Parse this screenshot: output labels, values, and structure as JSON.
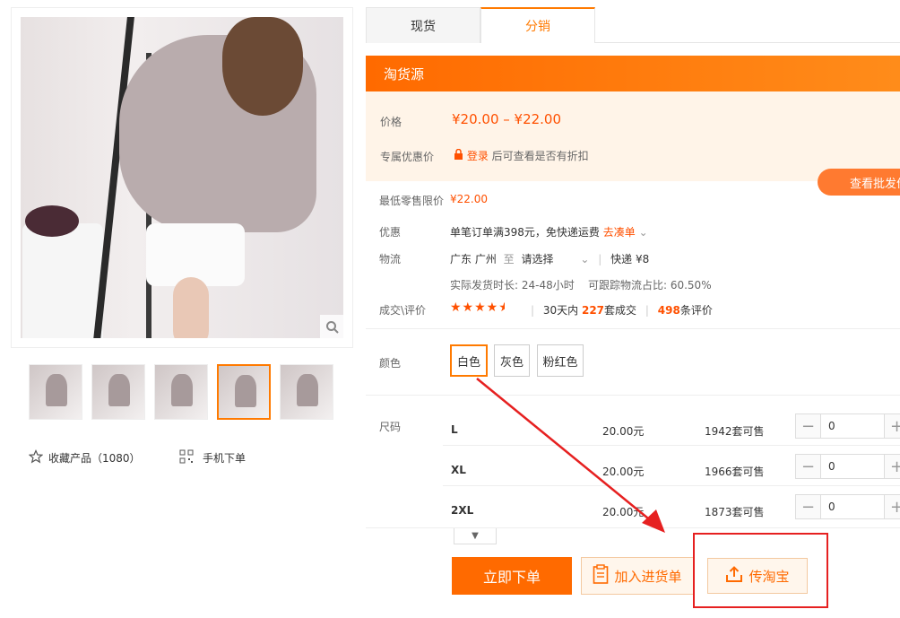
{
  "tabs": [
    {
      "label": "现货"
    },
    {
      "label": "分销"
    }
  ],
  "banner": {
    "title": "淘货源"
  },
  "price": {
    "label": "价格",
    "value": "¥20.00 – ¥22.00"
  },
  "exclusive": {
    "label": "专属优惠价",
    "login": "登录",
    "suffix": "后可查看是否有折扣"
  },
  "wholesale_button": "查看批发价",
  "min_retail": {
    "label": "最低零售限价",
    "value": "¥22.00"
  },
  "promo": {
    "label": "优惠",
    "text": "单笔订单满398元，免快递运费",
    "link": "去凑单"
  },
  "logistics": {
    "label": "物流",
    "from": "广东 广州",
    "to_word": "至",
    "select": "请选择",
    "method": "快递",
    "fee": "¥8",
    "detail": "实际发货时长: 24-48小时    可跟踪物流占比: 60.50%"
  },
  "reviews": {
    "label": "成交\\评价",
    "rating": 4.5,
    "days": "30天内",
    "sold": "227",
    "sold_unit": "套成交",
    "count": "498",
    "count_unit": "条评价"
  },
  "color": {
    "label": "颜色",
    "options": [
      "白色",
      "灰色",
      "粉红色"
    ],
    "selected": "白色"
  },
  "size": {
    "label": "尺码",
    "rows": [
      {
        "name": "L",
        "price": "20.00元",
        "stock": "1942套可售",
        "qty": "0"
      },
      {
        "name": "XL",
        "price": "20.00元",
        "stock": "1966套可售",
        "qty": "0"
      },
      {
        "name": "2XL",
        "price": "20.00元",
        "stock": "1873套可售",
        "qty": "0"
      }
    ]
  },
  "actions": {
    "order": "立即下单",
    "cart": "加入进货单",
    "taobao": "传淘宝"
  },
  "left": {
    "favorite": "收藏产品（1080）",
    "mobile_order": "手机下单"
  },
  "icons": {
    "star": "star-icon",
    "qr": "qrcode-icon",
    "zoom": "zoom-icon",
    "lock": "lock-icon",
    "upload": "upload-icon",
    "clipboard": "clipboard-icon"
  },
  "colors": {
    "accent": "#ff6a00",
    "price": "#ff5000",
    "highlight": "#e62020"
  }
}
